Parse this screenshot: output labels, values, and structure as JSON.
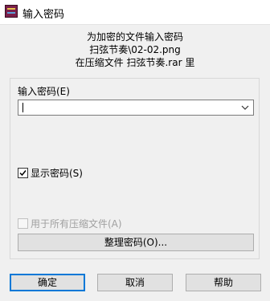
{
  "window": {
    "title": "输入密码",
    "app_icon": "winrar-books-icon"
  },
  "message": {
    "line1": "为加密的文件输入密码",
    "line2": "扫弦节奏\\02-02.png",
    "line3": "在压缩文件 扫弦节奏.rar 里"
  },
  "password": {
    "label": "输入密码(E)",
    "value": "",
    "dropdown_icon": "chevron-down-icon"
  },
  "options": {
    "show_password": {
      "label": "显示密码(S)",
      "checked": true
    },
    "use_for_all": {
      "label": "用于所有压缩文件(A)",
      "checked": false,
      "enabled": false
    }
  },
  "buttons": {
    "organize": "整理密码(O)...",
    "ok": "确定",
    "cancel": "取消",
    "help": "帮助"
  },
  "colors": {
    "background": "#f0f0f0",
    "accent": "#0078d7",
    "disabled_text": "#a0a0a0"
  }
}
